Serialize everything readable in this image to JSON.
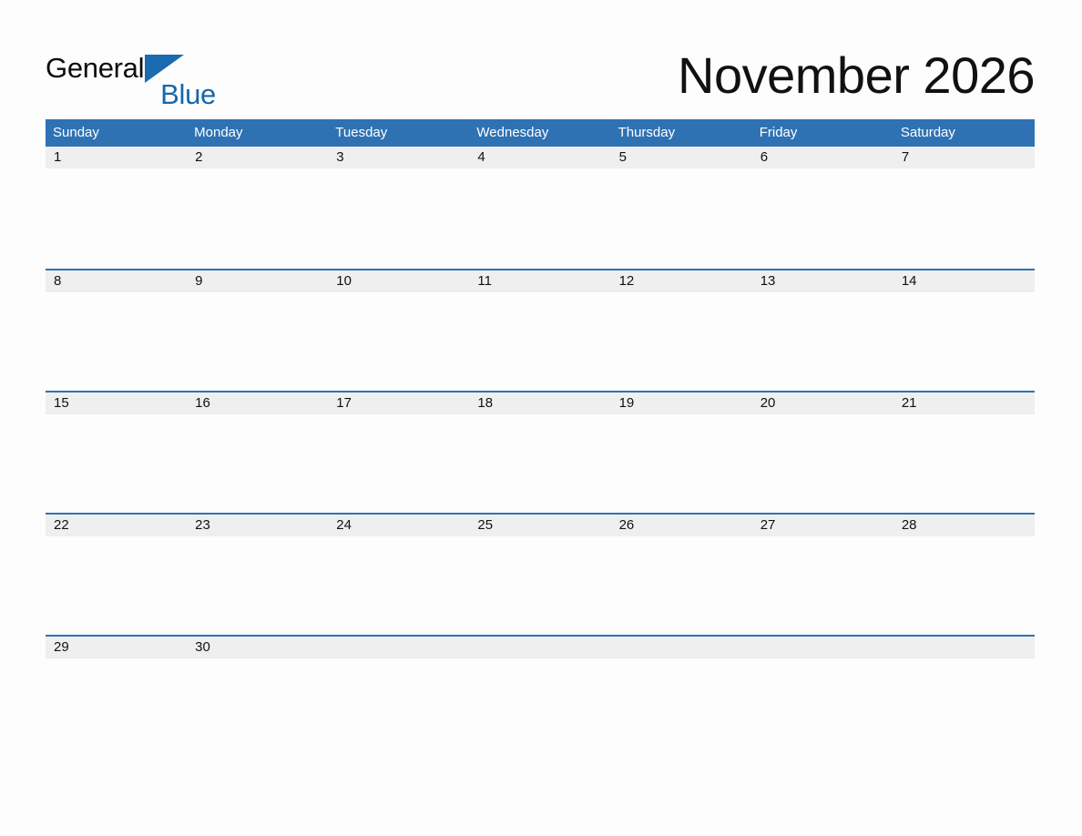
{
  "brand": {
    "name_part1": "General",
    "name_part2": "Blue",
    "triangle_icon": "blue-right-triangle",
    "accent_color": "#2e72b4",
    "logo_blue_color": "#1767ab"
  },
  "header": {
    "title": "November 2026",
    "month": "November",
    "year": "2026"
  },
  "calendar": {
    "weekday_headers": [
      "Sunday",
      "Monday",
      "Tuesday",
      "Wednesday",
      "Thursday",
      "Friday",
      "Saturday"
    ],
    "header_bg_color": "#2e72b4",
    "date_band_color": "#efefef",
    "separator_color": "#2e72b4",
    "weeks": [
      {
        "days": [
          {
            "date": "1",
            "events": ""
          },
          {
            "date": "2",
            "events": ""
          },
          {
            "date": "3",
            "events": ""
          },
          {
            "date": "4",
            "events": ""
          },
          {
            "date": "5",
            "events": ""
          },
          {
            "date": "6",
            "events": ""
          },
          {
            "date": "7",
            "events": ""
          }
        ]
      },
      {
        "days": [
          {
            "date": "8",
            "events": ""
          },
          {
            "date": "9",
            "events": ""
          },
          {
            "date": "10",
            "events": ""
          },
          {
            "date": "11",
            "events": ""
          },
          {
            "date": "12",
            "events": ""
          },
          {
            "date": "13",
            "events": ""
          },
          {
            "date": "14",
            "events": ""
          }
        ]
      },
      {
        "days": [
          {
            "date": "15",
            "events": ""
          },
          {
            "date": "16",
            "events": ""
          },
          {
            "date": "17",
            "events": ""
          },
          {
            "date": "18",
            "events": ""
          },
          {
            "date": "19",
            "events": ""
          },
          {
            "date": "20",
            "events": ""
          },
          {
            "date": "21",
            "events": ""
          }
        ]
      },
      {
        "days": [
          {
            "date": "22",
            "events": ""
          },
          {
            "date": "23",
            "events": ""
          },
          {
            "date": "24",
            "events": ""
          },
          {
            "date": "25",
            "events": ""
          },
          {
            "date": "26",
            "events": ""
          },
          {
            "date": "27",
            "events": ""
          },
          {
            "date": "28",
            "events": ""
          }
        ]
      },
      {
        "days": [
          {
            "date": "29",
            "events": ""
          },
          {
            "date": "30",
            "events": ""
          },
          {
            "date": "",
            "events": ""
          },
          {
            "date": "",
            "events": ""
          },
          {
            "date": "",
            "events": ""
          },
          {
            "date": "",
            "events": ""
          },
          {
            "date": "",
            "events": ""
          }
        ]
      }
    ]
  }
}
